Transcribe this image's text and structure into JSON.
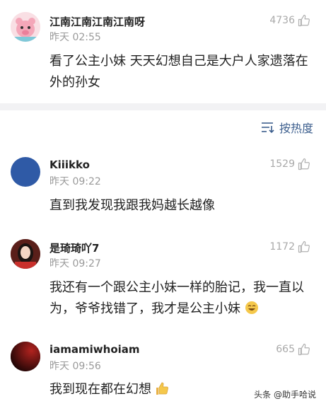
{
  "comments": [
    {
      "username": "江南江南江南江南呀",
      "time": "昨天 02:55",
      "likes": "4736",
      "text": "看了公主小妹  天天幻想自己是大户人家遗落在外的孙女",
      "avatar_icon": "cartoon-pig-avatar"
    },
    {
      "username": "Kiiikko",
      "time": "昨天 09:22",
      "likes": "1529",
      "text": "直到我发现我跟我妈越长越像",
      "avatar_icon": "blue-circle-avatar",
      "avatar_color": "#2f5aa6"
    },
    {
      "username": "是琦琦吖7",
      "time": "昨天 09:27",
      "likes": "1172",
      "text": "我还有一个跟公主小妹一样的胎记，我一直以为，爷爷找错了，我才是公主小妹",
      "avatar_icon": "girl-photo-avatar",
      "trailing_icon": "laughing-face-emoji"
    },
    {
      "username": "iamamiwhoiam",
      "time": "昨天 09:56",
      "likes": "665",
      "text": "我到现在都在幻想",
      "avatar_icon": "dark-red-avatar",
      "trailing_icon": "thumbs-up-emoji"
    }
  ],
  "sort": {
    "label": "按热度",
    "icon": "sort-icon",
    "color": "#3d5f8e"
  },
  "watermark": "头条 @助手哈说"
}
